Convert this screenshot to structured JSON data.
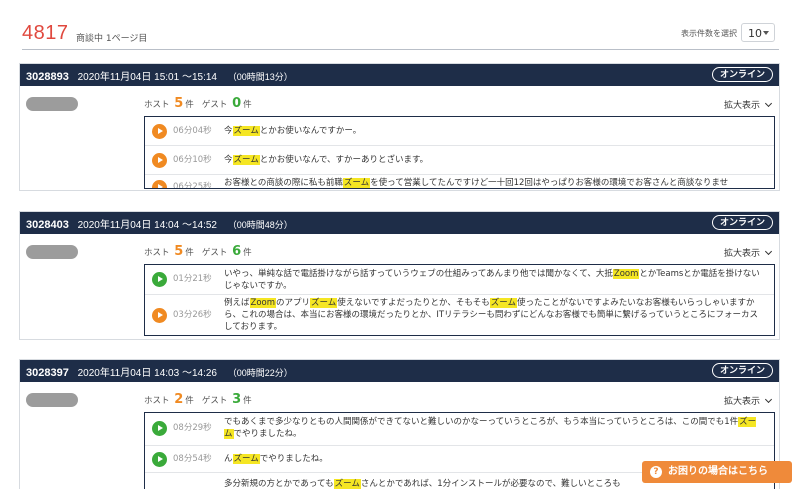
{
  "header": {
    "count": "4817",
    "count_sub": "商談中  1ページ目",
    "select_label": "表示件数を選択",
    "select_value": "10"
  },
  "common": {
    "online_label": "オンライン",
    "host_label": "ホスト",
    "guest_label": "ゲスト",
    "unit": "件",
    "expand_label": "拡大表示"
  },
  "cards": [
    {
      "id": "3028893",
      "datetime": "2020年11月04日  15:01 ～15:14",
      "duration": "（00時間13分）",
      "host_count": "5",
      "guest_count": "0",
      "rows": [
        {
          "time": "06分04秒",
          "pre": "今",
          "kw": "ズーム",
          "post": "とかお使いなんですかー。"
        },
        {
          "time": "06分10秒",
          "pre": "今",
          "kw": "ズーム",
          "post": "とかお使いなんで、すかーありとざいます。"
        },
        {
          "time": "06分25秒",
          "pre": "お客様との商談の際に私も前職",
          "kw": "ズーム",
          "post": "を使って営業してたんですけど一十回12回はやっぱりお客様の環境でお客さんと商談なりませ"
        }
      ]
    },
    {
      "id": "3028403",
      "datetime": "2020年11月04日  14:04 ～14:52",
      "duration": "（00時間48分）",
      "host_count": "5",
      "guest_count": "6",
      "rows": [
        {
          "time": "01分21秒",
          "pre": "いやっ、単純な話で電話掛けながら話すっていうウェブの仕組みってあんまり他では聞かなくて、大抵",
          "kw": "Zoom",
          "post": "とかTeamsとか電話を掛けないじゃないですか。"
        },
        {
          "time": "03分26秒",
          "pre": "例えば",
          "kw": "Zoom",
          "mid": "のアプリ",
          "kw2": "ズーム",
          "mid2": "使えないですよだったりとか、そもそも",
          "kw3": "ズーム",
          "post": "使ったことがないですよみたいなお客様もいらっしゃいますから、これの場合は、本当にお客様の環境だったりとか、ITリテラシーも問わずにどんなお客様でも簡単に繋げるっていうところにフォーカスしております。"
        }
      ]
    },
    {
      "id": "3028397",
      "datetime": "2020年11月04日  14:03 ～14:26",
      "duration": "（00時間22分）",
      "host_count": "2",
      "guest_count": "3",
      "rows": [
        {
          "time": "08分29秒",
          "pre": "でもあくまで多少なりともの人間関係ができてないと難しいのかなーっていうところが、もう本当にっていうところは、この間でも1件",
          "kw": "ズーム",
          "post": "でやりましたね。"
        },
        {
          "time": "08分54秒",
          "pre": "ん",
          "kw": "ズーム",
          "post": "でやりましたね。"
        },
        {
          "time": "",
          "pre": "多分新規の方とかであっても",
          "kw": "ズーム",
          "post": "さんとかであれば、1分インストールが必要なので、難しいところも"
        }
      ]
    }
  ],
  "help_label": "お困りの場合はこちら",
  "help_icon": "?",
  "colors": {
    "accent": "#e0483e",
    "header_bg": "#1e2d48",
    "orange": "#f08a22",
    "green": "#3aaa3a",
    "highlight": "#f5e623",
    "help": "#ef8a3a"
  }
}
